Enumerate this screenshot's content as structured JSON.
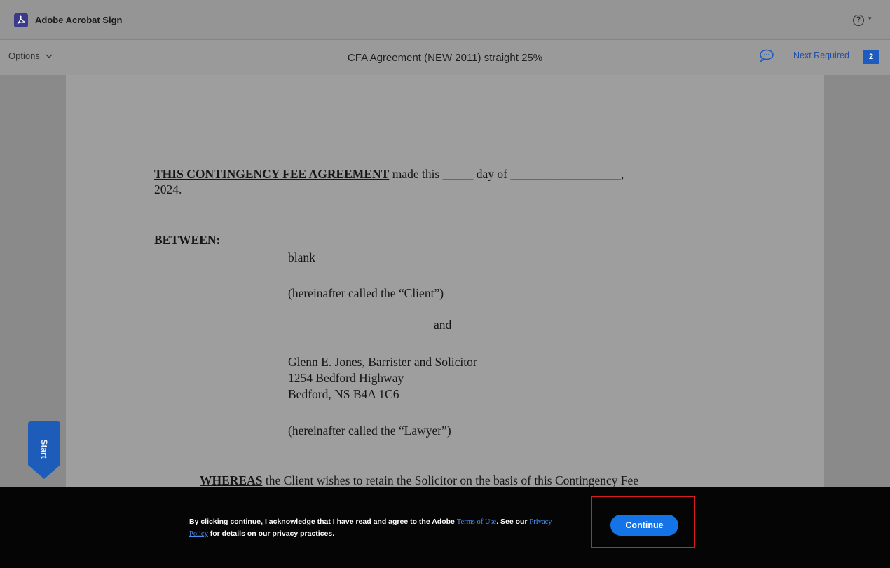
{
  "app": {
    "title": "Adobe Acrobat Sign",
    "help_symbol": "?",
    "help_caret": "▾"
  },
  "toolbar": {
    "options_label": "Options",
    "document_title": "CFA Agreement (NEW 2011) straight 25%",
    "next_required_label": "Next Required",
    "next_required_count": "2"
  },
  "document": {
    "heading": "THIS CONTINGENCY FEE AGREEMENT",
    "heading_rest": " made this _____ day of __________________,",
    "year_line": "2024.",
    "between_label": "BETWEEN:",
    "client_name": "blank",
    "client_note": "(hereinafter called the “Client”)",
    "and": "and",
    "lawyer_line1": "Glenn E. Jones, Barrister and Solicitor",
    "lawyer_line2": "1254 Bedford Highway",
    "lawyer_line3": "Bedford, NS B4A 1C6",
    "lawyer_note": "(hereinafter called the “Lawyer”)",
    "whereas_bold": "WHEREAS",
    "whereas_rest": " the Client wishes to retain the Solicitor on the basis of this Contingency Fee"
  },
  "start_tab": {
    "label": "Start"
  },
  "consent": {
    "text_before": "By clicking continue, I acknowledge that I have read and agree to the Adobe ",
    "terms_link": "Terms of Use",
    "text_mid": ". See our ",
    "privacy_link": "Privacy Policy",
    "text_after": " for details on our privacy practices.",
    "continue_label": "Continue"
  },
  "colors": {
    "accent": "#1473e6",
    "link": "#4a8ff0",
    "highlight": "#e01b1b"
  }
}
